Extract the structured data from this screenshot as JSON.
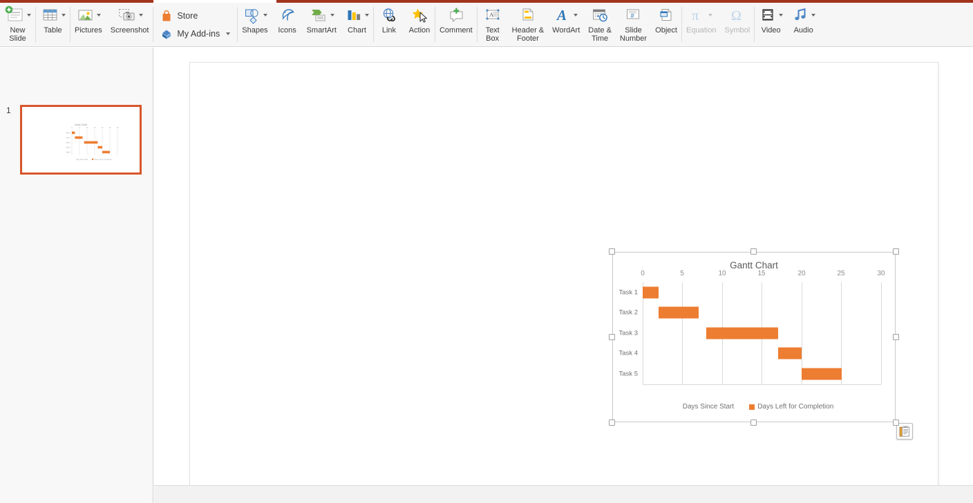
{
  "ribbon": {
    "groups": [
      {
        "name": "slides",
        "commands": [
          {
            "id": "new-slide",
            "label": "New\nSlide",
            "icon": "new-slide-icon",
            "caret": true,
            "disabled": false
          }
        ]
      },
      {
        "name": "tables",
        "commands": [
          {
            "id": "table",
            "label": "Table",
            "icon": "table-icon",
            "caret": true,
            "disabled": false
          }
        ]
      },
      {
        "name": "images",
        "commands": [
          {
            "id": "pictures",
            "label": "Pictures",
            "icon": "pictures-icon",
            "caret": true,
            "disabled": false
          },
          {
            "id": "screenshot",
            "label": "Screenshot",
            "icon": "screenshot-icon",
            "caret": true,
            "disabled": false
          }
        ]
      },
      {
        "name": "addins",
        "commands": [
          {
            "id": "store",
            "label": "Store",
            "icon": "store-icon",
            "caret": false,
            "disabled": false
          },
          {
            "id": "my-add-ins",
            "label": "My Add-ins",
            "icon": "add-ins-icon",
            "caret": true,
            "disabled": false
          }
        ]
      },
      {
        "name": "illustrations",
        "commands": [
          {
            "id": "shapes",
            "label": "Shapes",
            "icon": "shapes-icon",
            "caret": true,
            "disabled": false
          },
          {
            "id": "icons",
            "label": "Icons",
            "icon": "icons-icon",
            "caret": false,
            "disabled": false
          },
          {
            "id": "smartart",
            "label": "SmartArt",
            "icon": "smartart-icon",
            "caret": true,
            "disabled": false
          },
          {
            "id": "chart",
            "label": "Chart",
            "icon": "chart-icon",
            "caret": true,
            "disabled": false
          }
        ]
      },
      {
        "name": "links",
        "commands": [
          {
            "id": "link",
            "label": "Link",
            "icon": "link-icon",
            "caret": false,
            "disabled": false
          },
          {
            "id": "action",
            "label": "Action",
            "icon": "action-icon",
            "caret": false,
            "disabled": false
          }
        ]
      },
      {
        "name": "comments",
        "commands": [
          {
            "id": "comment",
            "label": "Comment",
            "icon": "comment-icon",
            "caret": false,
            "disabled": false
          }
        ]
      },
      {
        "name": "text",
        "commands": [
          {
            "id": "text-box",
            "label": "Text\nBox",
            "icon": "text-box-icon",
            "caret": false,
            "disabled": false
          },
          {
            "id": "header-footer",
            "label": "Header &\nFooter",
            "icon": "header-footer-icon",
            "caret": false,
            "disabled": false
          },
          {
            "id": "wordart",
            "label": "WordArt",
            "icon": "wordart-icon",
            "caret": true,
            "disabled": false
          },
          {
            "id": "date-time",
            "label": "Date &\nTime",
            "icon": "date-time-icon",
            "caret": false,
            "disabled": false
          },
          {
            "id": "slide-number",
            "label": "Slide\nNumber",
            "icon": "slide-number-icon",
            "caret": false,
            "disabled": false
          },
          {
            "id": "object",
            "label": "Object",
            "icon": "object-icon",
            "caret": false,
            "disabled": false
          }
        ]
      },
      {
        "name": "symbols",
        "commands": [
          {
            "id": "equation",
            "label": "Equation",
            "icon": "equation-icon",
            "caret": true,
            "disabled": true
          },
          {
            "id": "symbol",
            "label": "Symbol",
            "icon": "symbol-icon",
            "caret": false,
            "disabled": true
          }
        ]
      },
      {
        "name": "media",
        "commands": [
          {
            "id": "video",
            "label": "Video",
            "icon": "video-icon",
            "caret": true,
            "disabled": false
          },
          {
            "id": "audio",
            "label": "Audio",
            "icon": "audio-icon",
            "caret": true,
            "disabled": false
          }
        ]
      }
    ]
  },
  "thumbnails": {
    "slides": [
      {
        "number": "1",
        "selected": true
      }
    ]
  },
  "colors": {
    "accent_orange": "#ED7D31",
    "tab_stripe": "#A3341C",
    "thumb_selected_border": "#D8552A",
    "gridline": "#D9D9D9",
    "axis_text": "#8C8C8C",
    "title_text": "#595959"
  },
  "paste_button": {
    "label": "paste-options",
    "icon": "clipboard-icon"
  },
  "chart_data": {
    "type": "bar",
    "subtype": "stacked-horizontal-gantt",
    "title": "Gantt Chart",
    "xlabel": "",
    "ylabel": "",
    "orientation": "horizontal",
    "categories": [
      "Task 1",
      "Task 2",
      "Task 3",
      "Task 4",
      "Task 5"
    ],
    "xticks": [
      0,
      5,
      10,
      15,
      20,
      25,
      30
    ],
    "xlim": [
      0,
      30
    ],
    "grid": true,
    "legend_position": "bottom",
    "series": [
      {
        "name": "Days Since Start",
        "visible": false,
        "color": "transparent",
        "values": [
          0,
          2,
          8,
          17,
          20
        ]
      },
      {
        "name": "Days Left for Completion",
        "visible": true,
        "color": "#ED7D31",
        "values": [
          2,
          5,
          9,
          3,
          5
        ]
      }
    ],
    "bars": [
      {
        "category": "Task 1",
        "start": 0,
        "end": 2,
        "duration": 2
      },
      {
        "category": "Task 2",
        "start": 2,
        "end": 7,
        "duration": 5
      },
      {
        "category": "Task 3",
        "start": 8,
        "end": 17,
        "duration": 9
      },
      {
        "category": "Task 4",
        "start": 17,
        "end": 20,
        "duration": 3
      },
      {
        "category": "Task 5",
        "start": 20,
        "end": 25,
        "duration": 5
      }
    ]
  }
}
